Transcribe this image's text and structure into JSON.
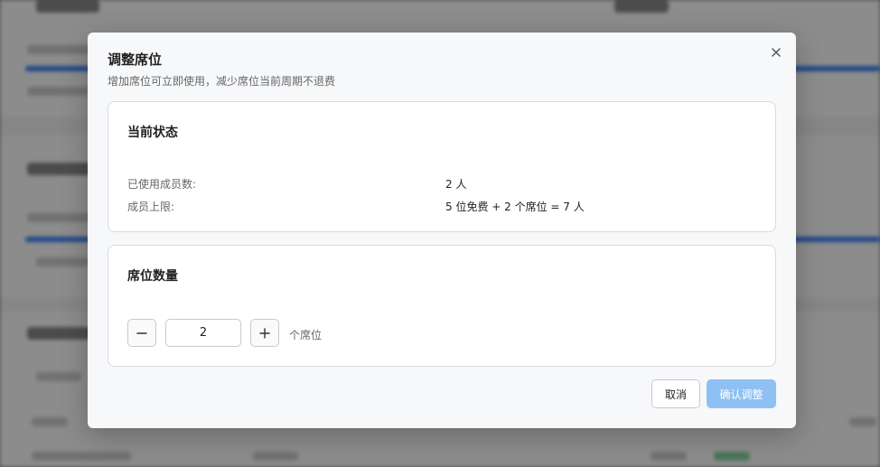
{
  "modal": {
    "title": "调整席位",
    "subtitle": "增加席位可立即使用，减少席位当前周期不退费"
  },
  "status_panel": {
    "title": "当前状态",
    "rows": [
      {
        "label": "已使用成员数:",
        "value": "2 人"
      },
      {
        "label": "成员上限:",
        "value": "5 位免费 + 2 个席位 = 7 人"
      }
    ]
  },
  "seats_panel": {
    "title": "席位数量",
    "quantity": "2",
    "unit": "个席位"
  },
  "footer": {
    "cancel_label": "取消",
    "confirm_label": "确认调整"
  },
  "colors": {
    "confirm_button": "#8fc0f3",
    "overlay": "rgba(0,0,0,0.45)"
  },
  "icons": {
    "close": "close-icon",
    "minus": "minus-icon",
    "plus": "plus-icon"
  }
}
